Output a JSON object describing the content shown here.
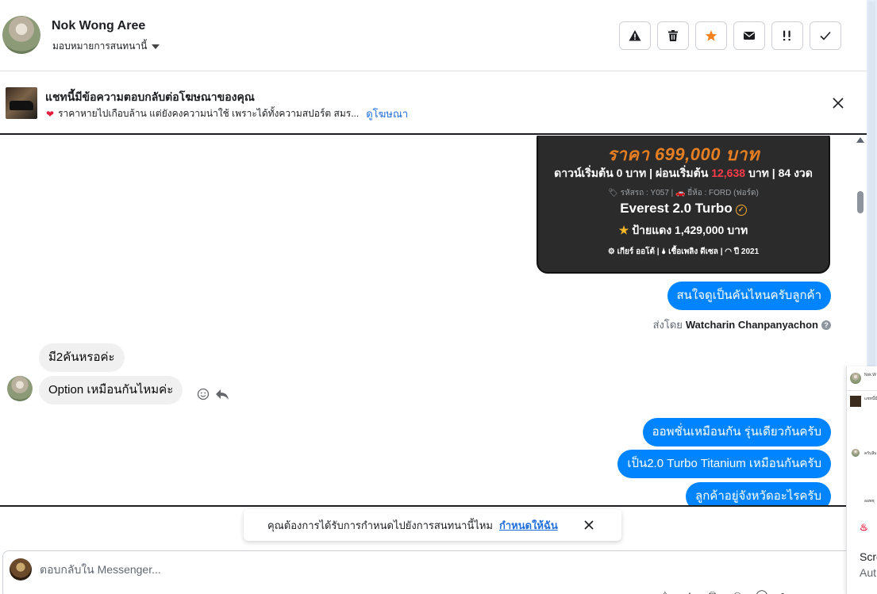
{
  "header": {
    "contact_name": "Nok Wong Aree",
    "assign_label": "มอบหมายการสนทนานี้",
    "toolbar": {
      "report": "warning-icon",
      "delete": "trash-icon",
      "star": "star-icon",
      "mark_unread": "envelope-icon",
      "follow_up": "double-exclamation-icon",
      "done": "check-icon"
    },
    "star_color": "#f5821f"
  },
  "ad_banner": {
    "title": "แชทนี้มีข้อความตอบกลับต่อโฆษณาของคุณ",
    "description": "ราคาหายไปเกือบล้าน แต่ยังคงความน่าใช้ เพราะได้ทั้งความสปอร์ต สมร...",
    "link": "ดูโฆษณา"
  },
  "ad_card": {
    "price": "ราคา 699,000 บาท",
    "down_prefix": "ดาวน์เริ่มต้น 0 บาท | ผ่อนเริ่มต้น",
    "installment": "12,638",
    "down_suffix": "บาท | 84 งวด",
    "meta": "🏷 รหัสรถ : Y057 | 🚗 ยี่ห้อ : FORD (ฟอร์ด)",
    "model": "Everest 2.0 Turbo",
    "red_plate": "ป้ายแดง 1,429,000 บาท",
    "specs": "⚙ เกียร์ ออโต้   |  🌢 เชื้อเพลิง ดีเซล   |  ◠ ปี 2021"
  },
  "messages": {
    "out_1": "สนใจดูเป็นคันไหนครับลูกค้า",
    "sent_by_prefix": "ส่งโดย",
    "sent_by_name": "Watcharin Chanpanyachon",
    "in_1": "มี2คันหรอค่ะ",
    "in_2": "Option เหมือนกันไหมค่ะ",
    "out_2": "ออพชั่นเหมือนกัน รุ่นเดียวกันครับ",
    "out_3": "เป็น2.0 Turbo Titanium เหมือนกันครับ",
    "out_4": "ลูกค้าอยู่จังหวัดอะไรครับ"
  },
  "toast": {
    "text": "คุณต้องการได้รับการกำหนดไปยังการสนทนานี้ไหม",
    "action": "กำหนดให้ฉัน"
  },
  "composer": {
    "placeholder": "ตอบกลับใน Messenger..."
  },
  "side_panel": {
    "name_snippet": "Nok W",
    "ad_snippet": "แชทนี้มี",
    "row_snippet": "ครับลีบ",
    "reply_snippet": "ออพชุ",
    "screen_label": "Scre",
    "auto_label": "Aut"
  },
  "colors": {
    "accent": "#0084ff",
    "link": "#216fdb",
    "incoming_bubble": "#f0f0f0",
    "ad_card_bg": "#2b2b2b",
    "price": "#e67e22",
    "installment_red": "#ff3b4a"
  }
}
